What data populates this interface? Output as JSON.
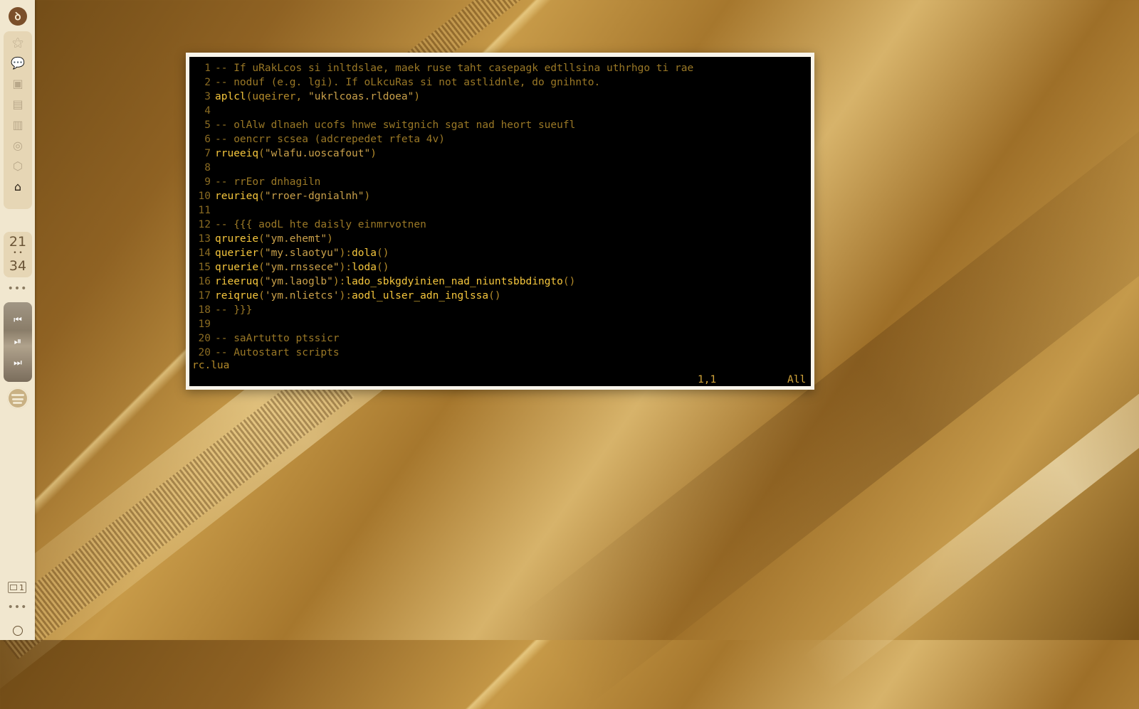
{
  "sidebar": {
    "logo_glyph": "ꝺ",
    "dock_icons": [
      "star-icon",
      "chat-icon",
      "camera-icon",
      "gallery-icon",
      "library-icon",
      "sync-icon",
      "cube-icon",
      "home-icon"
    ],
    "dock_glyphs": [
      "⚝",
      "💬",
      "▣",
      "▤",
      "▥",
      "◎",
      "⬡",
      "⌂"
    ],
    "clock": {
      "hour": "21",
      "minute": "34",
      "sep": "• •"
    },
    "more_dots": "•••",
    "media": {
      "prev": "⏮",
      "playpause": "⏯",
      "next": "⏭"
    },
    "workspace": "1",
    "more_dots_bottom": "•••"
  },
  "editor": {
    "lines": [
      {
        "n": "1",
        "parts": [
          [
            "cmt",
            "-- If uRakLcos si inltdslae, maek ruse taht casepagk edtllsina uthrhgo ti rae"
          ]
        ]
      },
      {
        "n": "2",
        "parts": [
          [
            "cmt",
            "-- noduf (e.g. lgi). If oLkcuRas si not astlidnle, do gnihnto."
          ]
        ]
      },
      {
        "n": "3",
        "parts": [
          [
            "fn",
            "aplcl"
          ],
          [
            "punc",
            "(uqeirer, "
          ],
          [
            "str",
            "\"ukrlcoas.rldoea\""
          ],
          [
            "punc",
            ")"
          ]
        ]
      },
      {
        "n": "4",
        "parts": []
      },
      {
        "n": "5",
        "parts": [
          [
            "cmt",
            "-- olAlw dlnaeh ucofs hnwe switgnich sgat nad heort sueufl"
          ]
        ]
      },
      {
        "n": "6",
        "parts": [
          [
            "cmt",
            "-- oencrr scsea (adcrepedet rfeta 4v)"
          ]
        ]
      },
      {
        "n": "7",
        "parts": [
          [
            "fn",
            "rrueeiq"
          ],
          [
            "punc",
            "("
          ],
          [
            "str",
            "\"wlafu.uoscafout\""
          ],
          [
            "punc",
            ")"
          ]
        ]
      },
      {
        "n": "8",
        "parts": []
      },
      {
        "n": "9",
        "parts": [
          [
            "cmt",
            "-- rrEor dnhagiln"
          ]
        ]
      },
      {
        "n": "10",
        "parts": [
          [
            "fn",
            "reurieq"
          ],
          [
            "punc",
            "("
          ],
          [
            "str",
            "\"rroer-dgnialnh\""
          ],
          [
            "punc",
            ")"
          ]
        ]
      },
      {
        "n": "11",
        "parts": []
      },
      {
        "n": "12",
        "parts": [
          [
            "cmt",
            "-- {{{ aodL hte daisly einmrvotnen"
          ]
        ]
      },
      {
        "n": "13",
        "parts": [
          [
            "fn",
            "qrureie"
          ],
          [
            "punc",
            "("
          ],
          [
            "str",
            "\"ym.ehemt\""
          ],
          [
            "punc",
            ")"
          ]
        ]
      },
      {
        "n": "14",
        "parts": [
          [
            "fn",
            "querier"
          ],
          [
            "punc",
            "("
          ],
          [
            "str",
            "\"my.slaotyu\""
          ],
          [
            "punc",
            "):"
          ],
          [
            "fn",
            "dola"
          ],
          [
            "punc",
            "()"
          ]
        ]
      },
      {
        "n": "15",
        "parts": [
          [
            "fn",
            "qruerie"
          ],
          [
            "punc",
            "("
          ],
          [
            "str",
            "\"ym.rnssece\""
          ],
          [
            "punc",
            "):"
          ],
          [
            "fn",
            "loda"
          ],
          [
            "punc",
            "()"
          ]
        ]
      },
      {
        "n": "16",
        "parts": [
          [
            "fn",
            "rieeruq"
          ],
          [
            "punc",
            "("
          ],
          [
            "str",
            "\"ym.laoglb\""
          ],
          [
            "punc",
            "):"
          ],
          [
            "fn",
            "lado_sbkgdyinien_nad_niuntsbbdingto"
          ],
          [
            "punc",
            "()"
          ]
        ]
      },
      {
        "n": "17",
        "parts": [
          [
            "fn",
            "reiqrue"
          ],
          [
            "punc",
            "("
          ],
          [
            "str",
            "'ym.nlietcs'"
          ],
          [
            "punc",
            "):"
          ],
          [
            "fn",
            "aodl_ulser_adn_inglssa"
          ],
          [
            "punc",
            "()"
          ]
        ]
      },
      {
        "n": "18",
        "parts": [
          [
            "cmt",
            "-- }}}"
          ]
        ]
      },
      {
        "n": "19",
        "parts": []
      },
      {
        "n": "20",
        "parts": [
          [
            "cmt",
            "-- saArtutto ptssicr"
          ]
        ]
      },
      {
        "n": "20",
        "parts": [
          [
            "cmt",
            "-- Autostart scripts"
          ]
        ]
      }
    ],
    "filename": "rc.lua",
    "cursor_pos": "1,1",
    "scroll_pos": "All"
  },
  "colors": {
    "comment": "#9a7826",
    "function": "#f5c63d",
    "punctuation": "#b38a2a",
    "string": "#c9a04a",
    "line_number": "#8a6b22"
  }
}
